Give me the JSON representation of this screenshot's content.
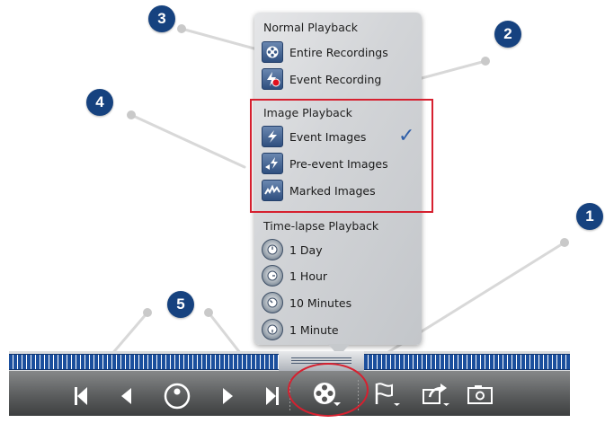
{
  "menu": {
    "normal_title": "Normal Playback",
    "normal_items": [
      {
        "label": "Entire Recordings",
        "icon": "film-reel-icon"
      },
      {
        "label": "Event Recording",
        "icon": "event-recording-icon"
      }
    ],
    "image_title": "Image Playback",
    "image_items": [
      {
        "label": "Event Images",
        "icon": "lightning-icon",
        "checked": true
      },
      {
        "label": "Pre-event Images",
        "icon": "pre-event-icon"
      },
      {
        "label": "Marked Images",
        "icon": "marked-images-icon"
      }
    ],
    "timelapse_title": "Time-lapse Playback",
    "timelapse_items": [
      {
        "label": "1 Day",
        "icon": "timer-icon"
      },
      {
        "label": "1 Hour",
        "icon": "timer-icon"
      },
      {
        "label": "10 Minutes",
        "icon": "timer-icon"
      },
      {
        "label": "1 Minute",
        "icon": "timer-icon"
      }
    ],
    "checkmark": "✓"
  },
  "callouts": [
    "1",
    "2",
    "3",
    "4",
    "5"
  ],
  "colors": {
    "badge": "#16427f",
    "highlight": "#d6202f",
    "timeline": "#1b4f9d"
  },
  "toolbar": {
    "buttons": [
      "skip-to-start-icon",
      "step-back-icon",
      "record-dial-icon",
      "step-forward-icon",
      "skip-to-end-icon",
      "playback-mode-icon",
      "flag-icon",
      "share-export-icon",
      "snapshot-icon"
    ]
  }
}
